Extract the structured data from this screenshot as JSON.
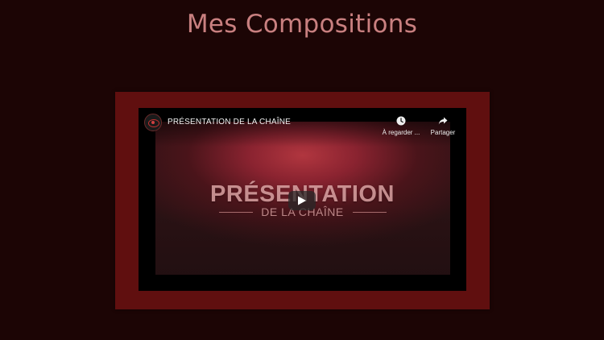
{
  "page": {
    "title": "Mes Compositions"
  },
  "video": {
    "title": "PRÉSENTATION DE LA CHAÎNE",
    "watch_later_label": "À regarder ...",
    "share_label": "Partager",
    "thumbnail_main_text": "PRÉSENTATION",
    "thumbnail_sub_text": "DE LA CHAÎNE"
  },
  "icons": {
    "avatar": "channel-logo",
    "watch_later": "clock-icon",
    "share": "share-arrow-icon",
    "play": "play-icon"
  },
  "colors": {
    "background": "#1c0505",
    "title": "#c98080",
    "frame": "#600f0f",
    "accent": "#b1363f"
  }
}
